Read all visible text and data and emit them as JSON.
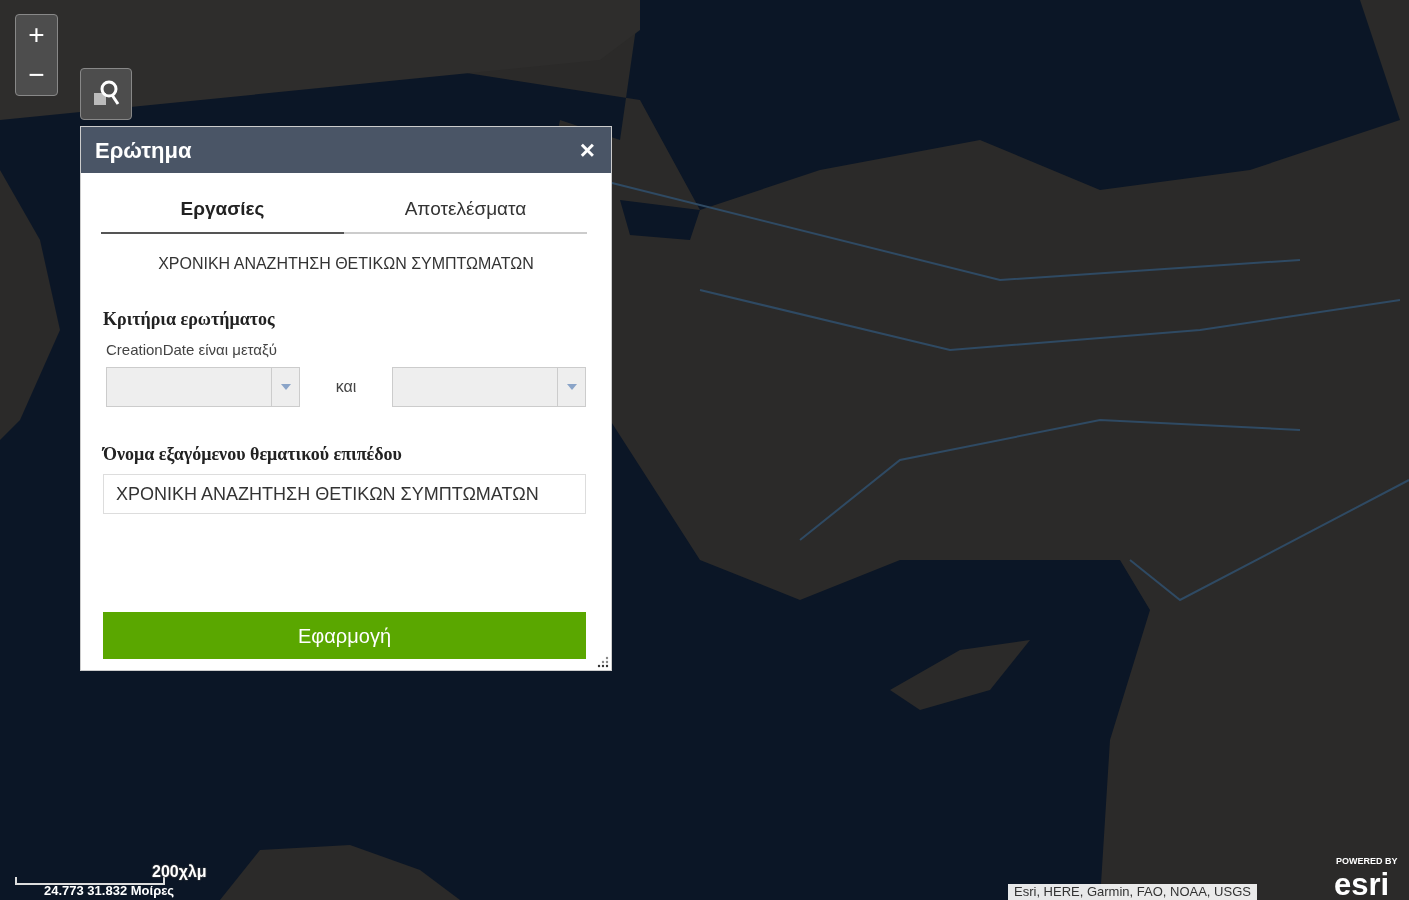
{
  "zoom_controls": {
    "zoom_in": "+",
    "zoom_out": "−"
  },
  "dialog": {
    "title": "Ερώτημα",
    "close": "×",
    "tabs": [
      {
        "label": "Εργασίες",
        "selected": true
      },
      {
        "label": "Αποτελέσματα",
        "selected": false
      }
    ],
    "task_title": "ΧΡΟΝΙΚΗ ΑΝΑΖΗΤΗΣΗ ΘΕΤΙΚΩΝ ΣΥΜΠΤΩΜΑΤΩΝ",
    "criteria_heading": "Κριτήρια ερωτήματος",
    "criteria_label": "CreationDate είναι μεταξύ",
    "conjunction": "και",
    "output_heading": "Όνομα εξαγόμενου θεματικού επιπέδου",
    "output_value": "ΧΡΟΝΙΚΗ ΑΝΑΖΗΤΗΣΗ ΘΕΤΙΚΩΝ ΣΥΜΠΤΩΜΑΤΩΝ",
    "apply_button": "Εφαρμογή"
  },
  "scale_bar": {
    "label": "200χλμ"
  },
  "coordinates": "24.773 31.832 Μοίρες",
  "attribution": "Esri, HERE, Garmin, FAO, NOAA, USGS",
  "logo": {
    "powered_by": "POWERED BY",
    "name": "esri"
  }
}
